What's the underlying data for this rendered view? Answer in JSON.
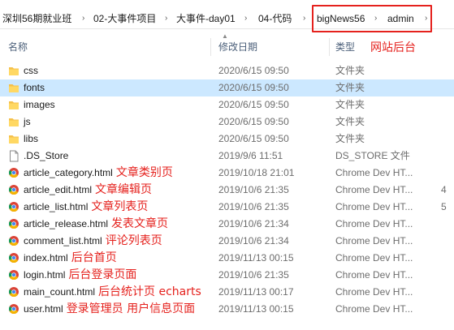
{
  "address_bar": {
    "segments": [
      "深圳56期就业班",
      "02-大事件项目",
      "大事件-day01",
      "04-代码",
      "bigNews56",
      "admin"
    ],
    "separator": "›",
    "highlight_color": "#e5211d"
  },
  "columns": {
    "name": "名称",
    "date": "修改日期",
    "type": "类型",
    "annotation": "网站后台"
  },
  "files": [
    {
      "name": "css",
      "date": "2020/6/15 09:50",
      "type": "文件夹",
      "icon": "folder-icon",
      "annotation": "",
      "tail": ""
    },
    {
      "name": "fonts",
      "date": "2020/6/15 09:50",
      "type": "文件夹",
      "icon": "folder-icon",
      "annotation": "",
      "tail": "",
      "selected": true
    },
    {
      "name": "images",
      "date": "2020/6/15 09:50",
      "type": "文件夹",
      "icon": "folder-icon",
      "annotation": "",
      "tail": ""
    },
    {
      "name": "js",
      "date": "2020/6/15 09:50",
      "type": "文件夹",
      "icon": "folder-icon",
      "annotation": "",
      "tail": ""
    },
    {
      "name": "libs",
      "date": "2020/6/15 09:50",
      "type": "文件夹",
      "icon": "folder-icon",
      "annotation": "",
      "tail": ""
    },
    {
      "name": ".DS_Store",
      "date": "2019/9/6 11:51",
      "type": "DS_STORE 文件",
      "icon": "file-icon",
      "annotation": "",
      "tail": ""
    },
    {
      "name": "article_category.html",
      "date": "2019/10/18 21:01",
      "type": "Chrome Dev HT...",
      "icon": "chrome-icon",
      "annotation": "文章类别页",
      "tail": ""
    },
    {
      "name": "article_edit.html",
      "date": "2019/10/6 21:35",
      "type": "Chrome Dev HT...",
      "icon": "chrome-icon",
      "annotation": "文章编辑页",
      "tail": "4"
    },
    {
      "name": "article_list.html",
      "date": "2019/10/6 21:35",
      "type": "Chrome Dev HT...",
      "icon": "chrome-icon",
      "annotation": "文章列表页",
      "tail": "5"
    },
    {
      "name": "article_release.html",
      "date": "2019/10/6 21:34",
      "type": "Chrome Dev HT...",
      "icon": "chrome-icon",
      "annotation": "发表文章页",
      "tail": ""
    },
    {
      "name": "comment_list.html",
      "date": "2019/10/6 21:34",
      "type": "Chrome Dev HT...",
      "icon": "chrome-icon",
      "annotation": "评论列表页",
      "tail": ""
    },
    {
      "name": "index.html",
      "date": "2019/11/13 00:15",
      "type": "Chrome Dev HT...",
      "icon": "chrome-icon",
      "annotation": "后台首页",
      "tail": ""
    },
    {
      "name": "login.html",
      "date": "2019/10/6 21:35",
      "type": "Chrome Dev HT...",
      "icon": "chrome-icon",
      "annotation": "后台登录页面",
      "tail": ""
    },
    {
      "name": "main_count.html",
      "date": "2019/11/13 00:17",
      "type": "Chrome Dev HT...",
      "icon": "chrome-icon",
      "annotation": "后台统计页 echarts",
      "tail": ""
    },
    {
      "name": "user.html",
      "date": "2019/11/13 00:15",
      "type": "Chrome Dev HT...",
      "icon": "chrome-icon",
      "annotation": "登录管理员 用户信息页面",
      "tail": ""
    }
  ]
}
